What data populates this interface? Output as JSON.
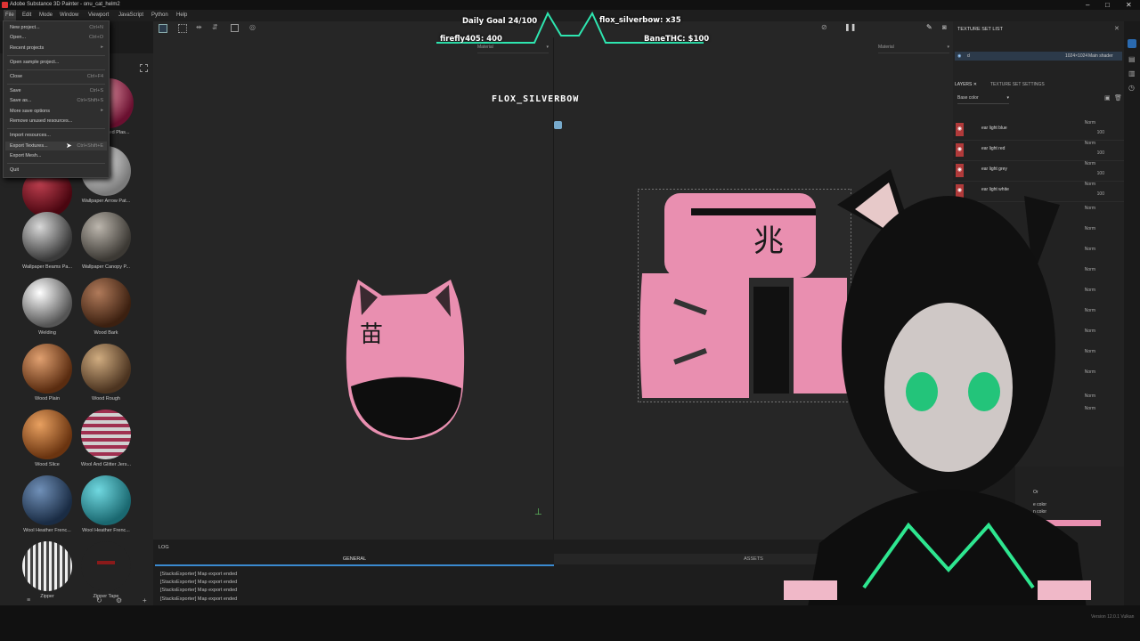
{
  "window": {
    "title": "Adobe Substance 3D Painter - onu_cat_helm2",
    "minimize": "–",
    "maximize": "□",
    "close": "✕"
  },
  "menubar": [
    "File",
    "Edit",
    "Mode",
    "Window",
    "Viewport",
    "JavaScript",
    "Python",
    "Help"
  ],
  "file_menu": [
    {
      "label": "New project...",
      "shortcut": "Ctrl+N"
    },
    {
      "label": "Open...",
      "shortcut": "Ctrl+O"
    },
    {
      "label": "Recent projects",
      "shortcut": "▸"
    },
    {
      "label": "Open sample project...",
      "shortcut": ""
    },
    {
      "label": "Close",
      "shortcut": "Ctrl+F4"
    },
    {
      "label": "Save",
      "shortcut": "Ctrl+S"
    },
    {
      "label": "Save as...",
      "shortcut": "Ctrl+Shift+S"
    },
    {
      "label": "More save options",
      "shortcut": "▸"
    },
    {
      "label": "Remove unused resources...",
      "shortcut": ""
    },
    {
      "label": "Import resources...",
      "shortcut": ""
    },
    {
      "label": "Export Textures...",
      "shortcut": "Ctrl+Shift+E"
    },
    {
      "label": "Export Mesh...",
      "shortcut": ""
    },
    {
      "label": "Quit",
      "shortcut": ""
    }
  ],
  "shelf": {
    "materials": [
      {
        "name": "Vinyl Heavy",
        "color": "#7a1120"
      },
      {
        "name": "Wallpaper Arrow Pat...",
        "color": "#b9b9b9"
      },
      {
        "name": "Wallpaper Beams Pa...",
        "color": "#8c8c8c"
      },
      {
        "name": "Wallpaper Canopy P...",
        "color": "#6e6a64"
      },
      {
        "name": "Welding",
        "color": "#c9c9c9"
      },
      {
        "name": "Wood Bark",
        "color": "#7a4e36"
      },
      {
        "name": "Wood Plain",
        "color": "#a7673a"
      },
      {
        "name": "Wood Rough",
        "color": "#9d7a57"
      },
      {
        "name": "Wood Slice",
        "color": "#b67a42"
      },
      {
        "name": "Wool And Glitter Jers...",
        "color": "#b5667a"
      },
      {
        "name": "Wool Heather Frenc...",
        "color": "#44627f"
      },
      {
        "name": "Wool Heather Frenc...",
        "color": "#3aa6b0"
      },
      {
        "name": "Zipper",
        "color": "#9a9a9a"
      },
      {
        "name": "Zipper Tape",
        "color": "#7a1a1a"
      }
    ],
    "partial_label": "nted Plas..."
  },
  "viewport": {
    "material_left": "Material",
    "material_right": "Material",
    "streamer_name": "FLOX_SILVERBOW"
  },
  "overlay": {
    "daily_goal": "Daily Goal 24/100",
    "top_right": "flox_silverbow: x35",
    "left_bits": "firefly405: 400",
    "right_bits": "BaneTHC: $100"
  },
  "log": {
    "title": "LOG",
    "tab_general": "GENERAL",
    "tab_assets": "ASSETS",
    "lines": [
      "[StacksExporter] Map export ended",
      "[StacksExporter] Map export ended",
      "[StacksExporter] Map export ended",
      "[StacksExporter] Map export ended"
    ]
  },
  "texture_set_list": {
    "title": "TEXTURE SET LIST",
    "set_name": "d",
    "resolution": "1024×1024",
    "shader": "Main shader"
  },
  "layers_panel": {
    "tab_layers": "LAYERS",
    "tab_settings": "TEXTURE SET SETTINGS",
    "channel": "Base color",
    "layers": [
      {
        "name": "ear light blue",
        "blend": "Norm",
        "value": "100"
      },
      {
        "name": "ear light red",
        "blend": "Norm",
        "value": "100"
      },
      {
        "name": "ear light grey",
        "blend": "Norm",
        "value": "100"
      },
      {
        "name": "ear light white",
        "blend": "Norm",
        "value": "100"
      }
    ],
    "extra_rows": [
      "Norm",
      "Norm",
      "Norm",
      "Norm",
      "Norm",
      "Norm",
      "Norm",
      "Norm",
      "Norm",
      "Norm",
      "Norm"
    ]
  },
  "properties": {
    "or": "Or",
    "base_color": "e color",
    "color_label": "n color"
  },
  "version": "Version 12.0.1 Vulkan"
}
